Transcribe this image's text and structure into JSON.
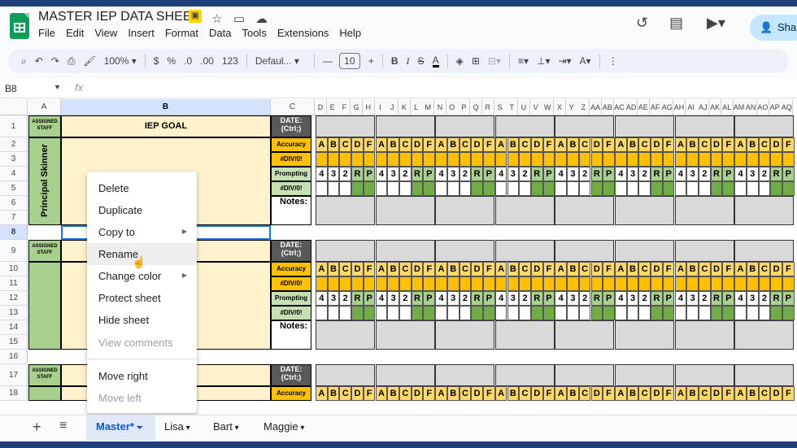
{
  "app": {
    "title": "MASTER IEP DATA SHEET"
  },
  "menu": [
    "File",
    "Edit",
    "View",
    "Insert",
    "Format",
    "Data",
    "Tools",
    "Extensions",
    "Help"
  ],
  "share_label": "Sha",
  "toolbar": {
    "zoom": "100%",
    "currency": "$",
    "percent": "%",
    "number_format": "123",
    "font": "Defaul...",
    "font_size": "10"
  },
  "namebox": "B8",
  "fx": "fx",
  "columns": [
    "A",
    "B",
    "C",
    "D",
    "E",
    "F",
    "G",
    "H",
    "I",
    "J",
    "K",
    "L",
    "M",
    "N",
    "O",
    "P",
    "Q",
    "R",
    "S",
    "T",
    "U",
    "V",
    "W",
    "X",
    "Y",
    "Z",
    "AA",
    "AB",
    "AC",
    "AD",
    "AE",
    "AF",
    "AG",
    "AH",
    "AI",
    "AJ",
    "AK",
    "AL",
    "AM",
    "AN",
    "AO",
    "AP",
    "AQ"
  ],
  "rows": [
    "1",
    "2",
    "3",
    "4",
    "5",
    "6",
    "7",
    "8",
    "9",
    "10",
    "11",
    "12",
    "13",
    "14",
    "15",
    "16",
    "17",
    "18"
  ],
  "sheet": {
    "assigned_staff": "ASSIGNED STAFF",
    "iep_goal": "IEP GOAL",
    "date": "DATE: (Ctrl;)",
    "accuracy": "Accuracy",
    "div": "#DIV/0!",
    "prompting": "Prompting",
    "notes": "Notes:",
    "staff_name": "Principal Skinner",
    "acc_letters": [
      "A",
      "B",
      "C",
      "D",
      "F"
    ],
    "prm_letters": [
      "4",
      "3",
      "2",
      "R",
      "P"
    ]
  },
  "context_menu": {
    "items": [
      {
        "label": "Delete",
        "disabled": false
      },
      {
        "label": "Duplicate",
        "disabled": false
      },
      {
        "label": "Copy to",
        "disabled": false,
        "submenu": true
      },
      {
        "label": "Rename",
        "disabled": false
      },
      {
        "label": "Change color",
        "disabled": false,
        "submenu": true
      },
      {
        "label": "Protect sheet",
        "disabled": false
      },
      {
        "label": "Hide sheet",
        "disabled": false
      },
      {
        "label": "View comments",
        "disabled": true
      },
      {
        "label": "Move right",
        "disabled": false
      },
      {
        "label": "Move left",
        "disabled": true
      }
    ]
  },
  "tabs": [
    {
      "label": "Master*",
      "active": true
    },
    {
      "label": "Lisa"
    },
    {
      "label": "Bart"
    },
    {
      "label": "Maggie"
    }
  ],
  "colors": {
    "accent": "#0b57d0",
    "brand": "#0f9d58",
    "yellow": "#ffc000",
    "green": "#a8d08d"
  }
}
